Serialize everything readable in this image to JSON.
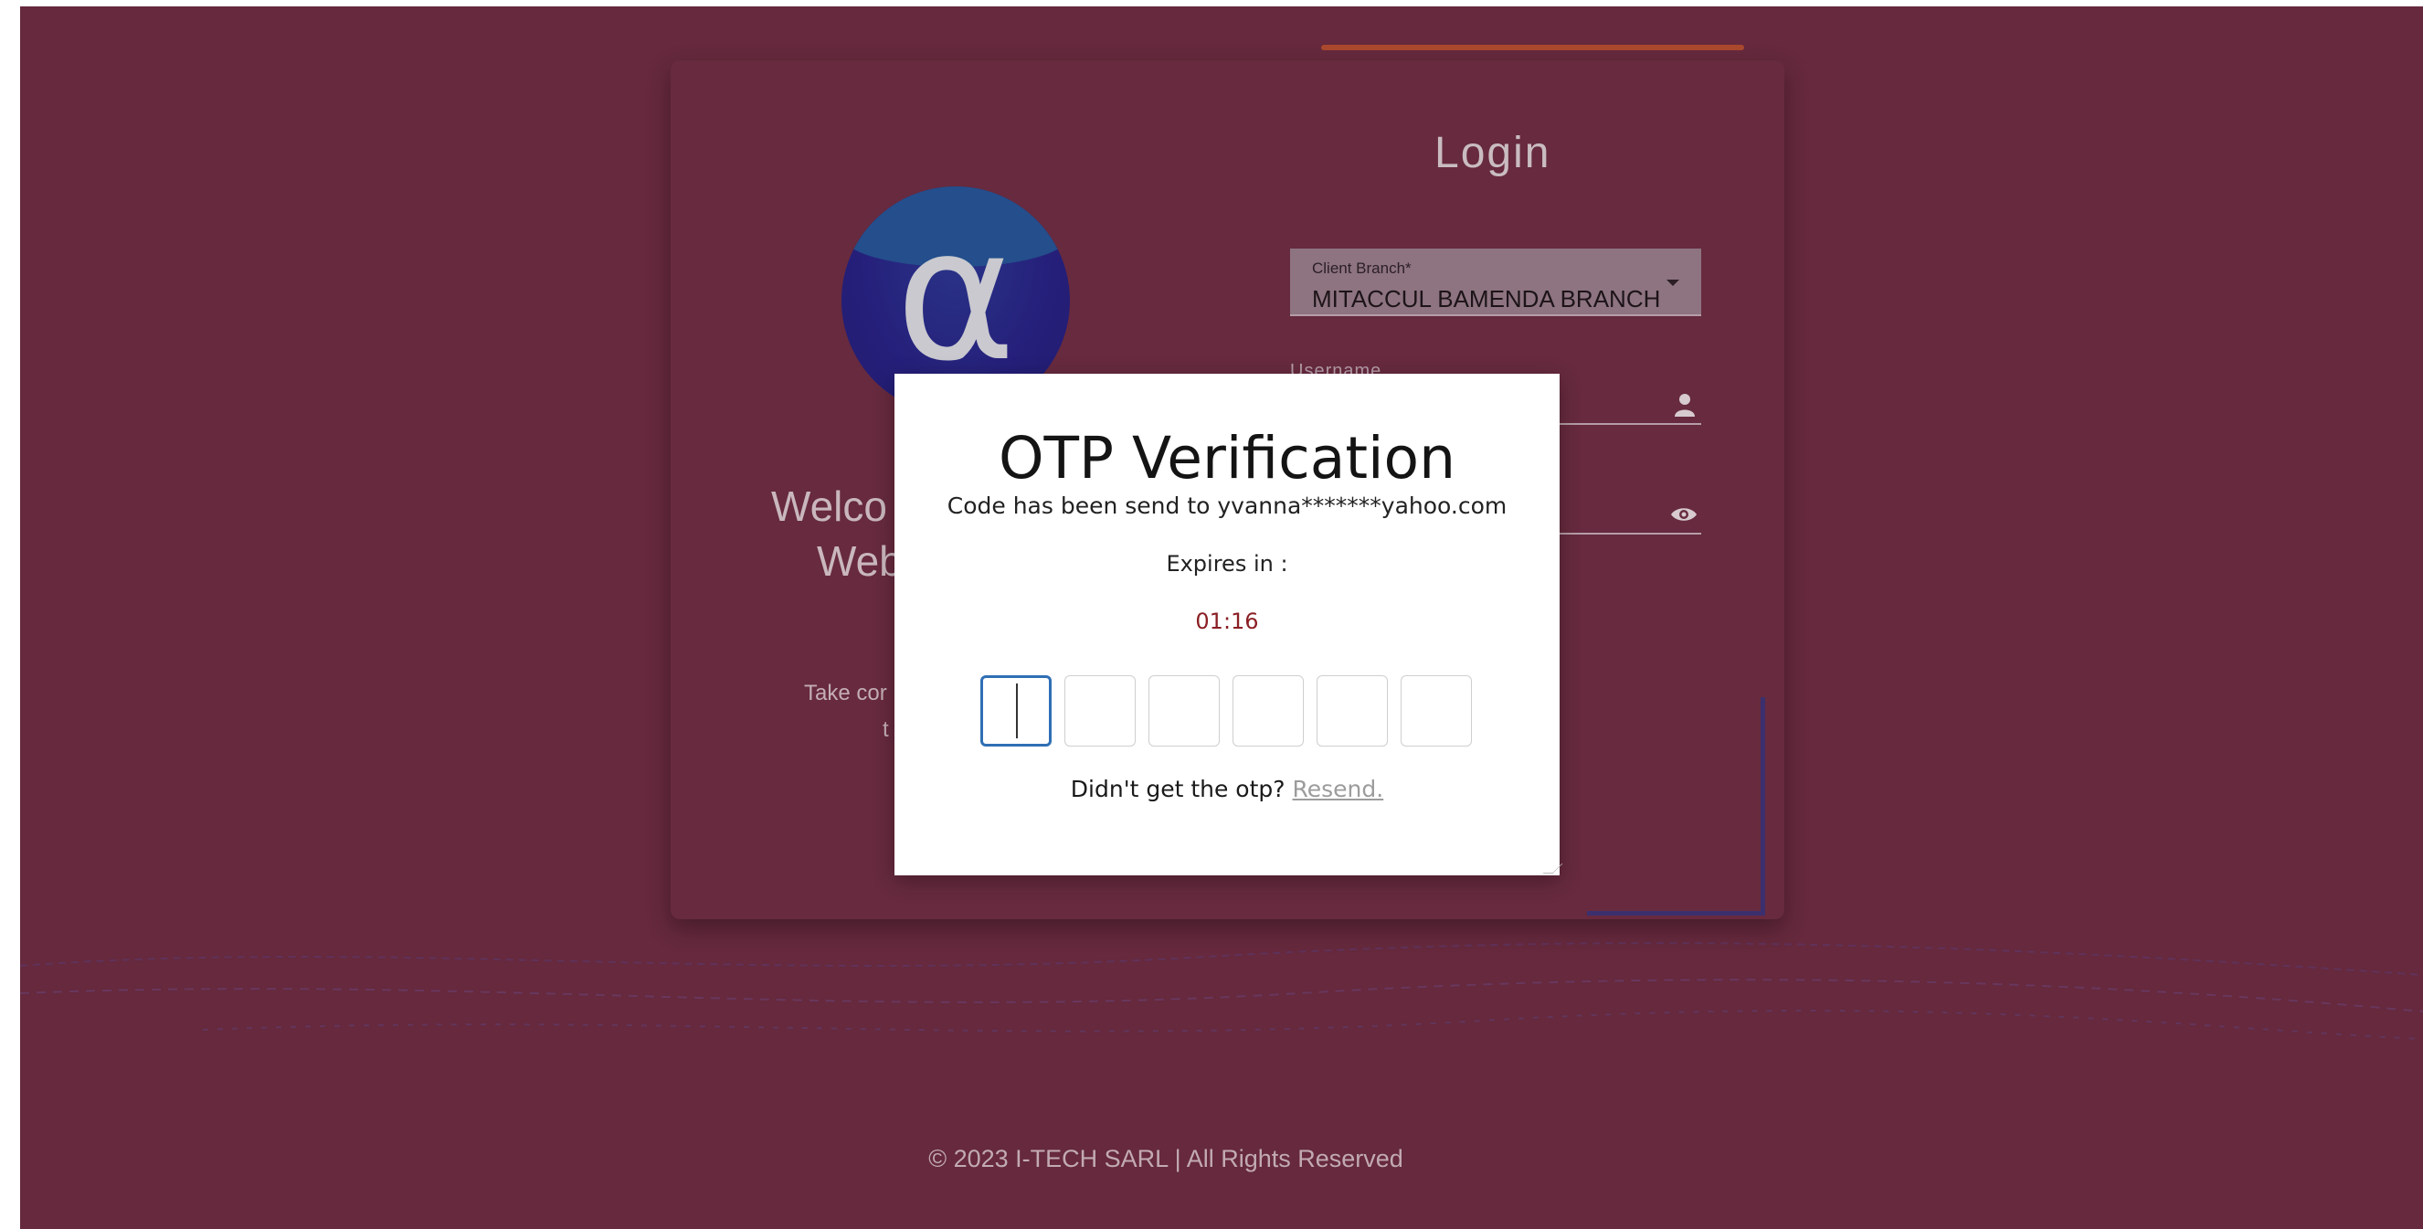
{
  "login": {
    "title": "Login",
    "welcome_line1": "Welco",
    "welcome_line2": "Web",
    "tagline_line1": "Take cor",
    "tagline_line2": "t",
    "client_branch_label": "Client Branch*",
    "client_branch_value": "MITACCUL BAMENDA BRANCH",
    "username_label": "Username",
    "logo_glyph": "α"
  },
  "otp": {
    "title": "OTP Verification",
    "sent_message": "Code has been send to yvanna*******yahoo.com",
    "expires_label": "Expires in :",
    "timer": "01:16",
    "digits": [
      "",
      "",
      "",
      "",
      "",
      ""
    ],
    "resend_prompt": "Didn't get the otp?",
    "resend_link": "Resend."
  },
  "footer": {
    "text": "© 2023 I-TECH SARL | All Rights Reserved"
  },
  "colors": {
    "background": "#66293d",
    "modal": "#ffffff",
    "active_box": "#2f6fb5",
    "timer": "#8a1f24"
  },
  "icons": {
    "username": "user-icon",
    "password": "eye-icon",
    "branch_dropdown": "caret-down-icon"
  }
}
